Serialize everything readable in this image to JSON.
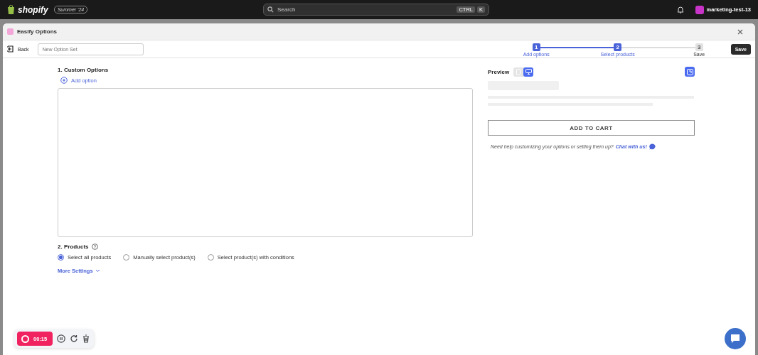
{
  "topbar": {
    "brand": "shopify",
    "badge": "Summer '24",
    "search": {
      "placeholder": "Search"
    },
    "shortcut": [
      "CTRL",
      "K"
    ],
    "store": "marketing-test-13"
  },
  "window": {
    "title": "Easify Options"
  },
  "toolbar": {
    "back": "Back",
    "name_field": {
      "placeholder": "New Option Set"
    },
    "save": "Save"
  },
  "steps": [
    {
      "number": "1",
      "label": "Add options",
      "active": true
    },
    {
      "number": "2",
      "label": "Select products",
      "active": true
    },
    {
      "number": "3",
      "label": "Save",
      "active": false
    }
  ],
  "custom_options": {
    "heading": "1. Custom Options",
    "add": "Add option"
  },
  "products": {
    "heading": "2. Products",
    "options": [
      {
        "label": "Select all products",
        "selected": true
      },
      {
        "label": "Manually select product(s)",
        "selected": false
      },
      {
        "label": "Select product(s) with conditions",
        "selected": false
      }
    ],
    "more": "More Settings"
  },
  "preview": {
    "heading": "Preview",
    "devices": [
      {
        "kind": "mobile",
        "selected": false
      },
      {
        "kind": "desktop",
        "selected": true
      }
    ],
    "button": "ADD TO CART",
    "help": "Need help customizing your options or setting them up?",
    "link": "Chat with us!"
  },
  "recorder": {
    "time": "00:15"
  }
}
